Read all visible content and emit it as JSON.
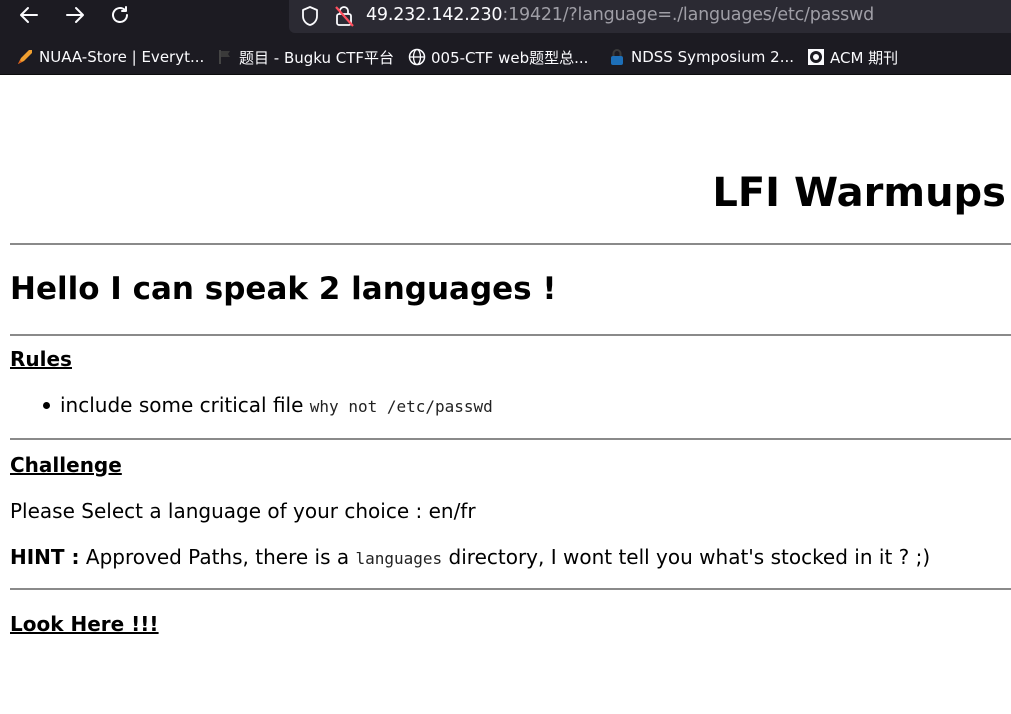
{
  "browser": {
    "url_host": "49.232.142.230",
    "url_rest": ":19421/?language=./languages/etc/passwd",
    "bookmarks": [
      {
        "label": "NUAA-Store | Everyt...",
        "icon": "rocket-icon"
      },
      {
        "label": "题目 - Bugku CTF平台",
        "icon": "flag-icon"
      },
      {
        "label": "005-CTF web题型总...",
        "icon": "globe-icon"
      },
      {
        "label": "NDSS Symposium 2...",
        "icon": "ndss-lock-icon"
      },
      {
        "label": "ACM 期刊",
        "icon": "acm-logo-icon"
      }
    ]
  },
  "page": {
    "title": "LFI Warmups",
    "heading": "Hello I can speak 2 languages !",
    "rules_title": "Rules",
    "rules": [
      {
        "text": "include some critical file ",
        "code": "why not /etc/passwd"
      }
    ],
    "challenge_title": "Challenge",
    "select_text": "Please Select a language of your choice : en/fr",
    "hint_label": "HINT :",
    "hint_pre": " Approved Paths, there is a ",
    "hint_code": "languages",
    "hint_post": " directory, I wont tell you what's stocked in it ? ;)",
    "look_here": "Look Here !!!"
  }
}
